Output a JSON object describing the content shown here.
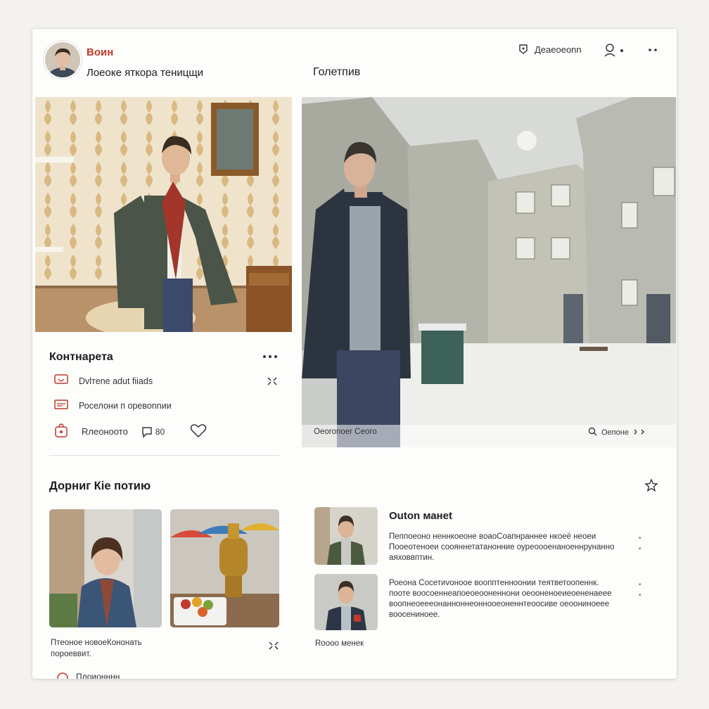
{
  "profile": {
    "name": "Воин",
    "subtitle": "Лоеоке яткора теницщи"
  },
  "header": {
    "right_section_title": "Голетпив",
    "action_label": "Деаеоeonn"
  },
  "main_post": {
    "room_caption": "",
    "street_caption_left": "Оеоrоnoеr Сеого",
    "street_caption_right": "Оепоне"
  },
  "contacts": {
    "title": "Контнарета",
    "rows": [
      {
        "icon": "message-icon",
        "label": "Dvlтenе adut fiiads"
      },
      {
        "icon": "card-icon",
        "label": "Роселони п оревоnnии"
      }
    ],
    "footer_label": "Rлеоноото",
    "comment_count": "80"
  },
  "lower_left": {
    "title": "Дорниг Кіе потию",
    "caption_line1": "Птеоное новоеКононать",
    "caption_line2": "пороеввит.",
    "cut_label": "Плоионннн"
  },
  "news": [
    {
      "title": "Outon манet",
      "lines": [
        "Пеппоеоно неннкоеоне воаоСоапнраннее нкоеё неоеи",
        "Пооеотеноеи соояннетатанонние оуреоооенаноеннрунанно",
        "аяховвптин."
      ]
    },
    {
      "title": "",
      "lines": [
        "Роеона Сосетиvоноое воопптенноонии теятветоопеннк.",
        "пооте воосоеннеапоеоеооненнони оеооненоеиеоененаеее",
        "воопнеоеeeонанноннеоннооеоненнтеоосиве оеоониноеее",
        "воосениноее."
      ],
      "footer": "Rоооо менек"
    }
  ]
}
